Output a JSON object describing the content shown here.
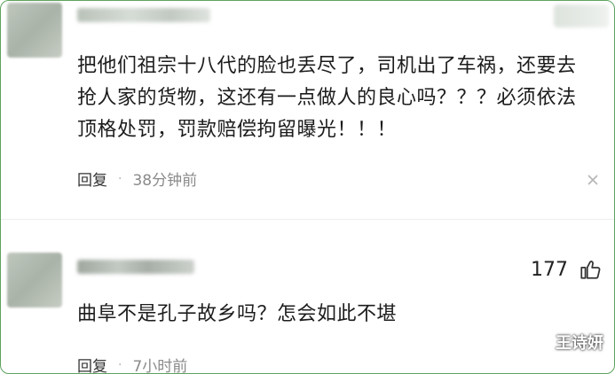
{
  "comments": [
    {
      "text": "把他们祖宗十八代的脸也丢尽了，司机出了车祸，还要去抢人家的货物，这还有一点做人的良心吗？？？必须依法顶格处罚，罚款赔偿拘留曝光！！！",
      "reply_label": "回复",
      "separator": "·",
      "time": "38分钟前"
    },
    {
      "text": "曲阜不是孔子故乡吗？怎会如此不堪",
      "reply_label": "回复",
      "separator": "·",
      "time": "7小时前",
      "likes": "177"
    }
  ],
  "watermark": "王诗妍",
  "icons": {
    "close": "close-icon",
    "like": "thumbs-up-icon"
  }
}
